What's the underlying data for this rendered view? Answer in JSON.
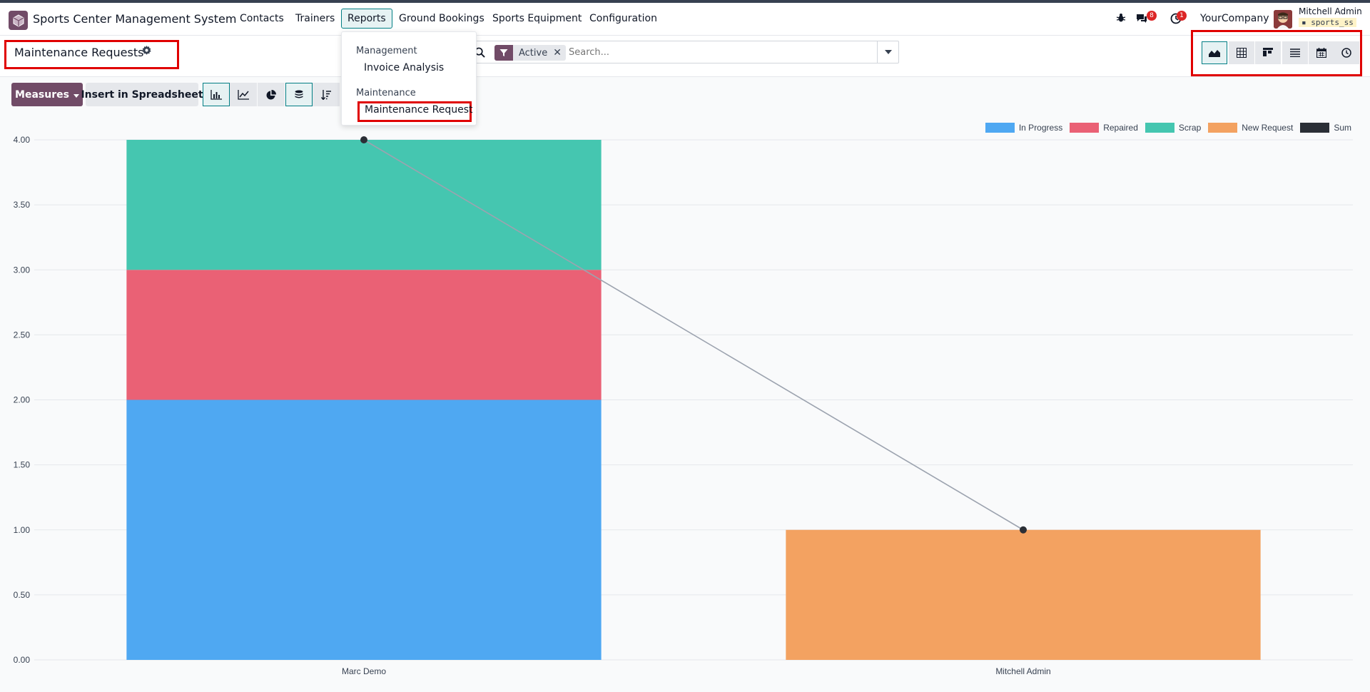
{
  "app": {
    "name": "Sports Center Management System",
    "icon": "app-box-icon"
  },
  "nav": {
    "items": [
      "Contacts",
      "Trainers",
      "Reports",
      "Ground Bookings",
      "Sports Equipment",
      "Configuration"
    ],
    "active": "Reports"
  },
  "systray": {
    "bug_icon": "bug-icon",
    "messages_icon": "chat-icon",
    "messages_count": "8",
    "activity_icon": "clock-icon",
    "activity_count": "1",
    "company": "YourCompany",
    "user_name": "Mitchell Admin",
    "database": "sports_ss"
  },
  "control": {
    "title": "Maintenance Requests",
    "gear_icon": "gear-icon",
    "search": {
      "facet_icon": "filter-icon",
      "facet_label": "Active",
      "placeholder": "Search...",
      "toggle_icon": "caret-down-icon"
    },
    "views": [
      "graph-view-icon",
      "pivot-view-icon",
      "kanban-view-icon",
      "list-view-icon",
      "calendar-view-icon",
      "activity-view-icon"
    ],
    "active_view": "graph-view-icon"
  },
  "toolbar": {
    "measures_label": "Measures",
    "spreadsheet_label": "Insert in Spreadsheet",
    "chart_buttons": [
      "bar-chart-icon",
      "line-chart-icon",
      "pie-chart-icon"
    ],
    "active_chart": "bar-chart-icon",
    "stacked_icon": "stack-icon",
    "stacked_active": true,
    "sort_icon": "sort-descending-icon"
  },
  "dropdown": {
    "sections": [
      {
        "header": "Management",
        "items": [
          "Invoice Analysis"
        ]
      },
      {
        "header": "Maintenance",
        "items": [
          "Maintenance Request"
        ]
      }
    ],
    "highlighted": "Maintenance Request"
  },
  "colors": {
    "brand": "#714b67",
    "accent": "#017e84",
    "in_progress": "#4fa8f2",
    "repaired": "#ea6175",
    "scrap": "#45c6b0",
    "new_request": "#f3a261",
    "sum": "#2b2f36"
  },
  "chart_data": {
    "type": "bar",
    "stacked": true,
    "categories": [
      "Marc Demo",
      "Mitchell Admin"
    ],
    "series": [
      {
        "name": "In Progress",
        "values": [
          2,
          0
        ],
        "color": "#4fa8f2"
      },
      {
        "name": "Repaired",
        "values": [
          1,
          0
        ],
        "color": "#ea6175"
      },
      {
        "name": "Scrap",
        "values": [
          1,
          0
        ],
        "color": "#45c6b0"
      },
      {
        "name": "New Request",
        "values": [
          0,
          1
        ],
        "color": "#f3a261"
      }
    ],
    "sum": {
      "name": "Sum",
      "values": [
        4,
        1
      ],
      "color": "#2b2f36"
    },
    "ylim": [
      0,
      4
    ],
    "yticks": [
      "0.00",
      "0.50",
      "1.00",
      "1.50",
      "2.00",
      "2.50",
      "3.00",
      "3.50",
      "4.00"
    ],
    "grid": true,
    "legend_position": "top-right"
  }
}
